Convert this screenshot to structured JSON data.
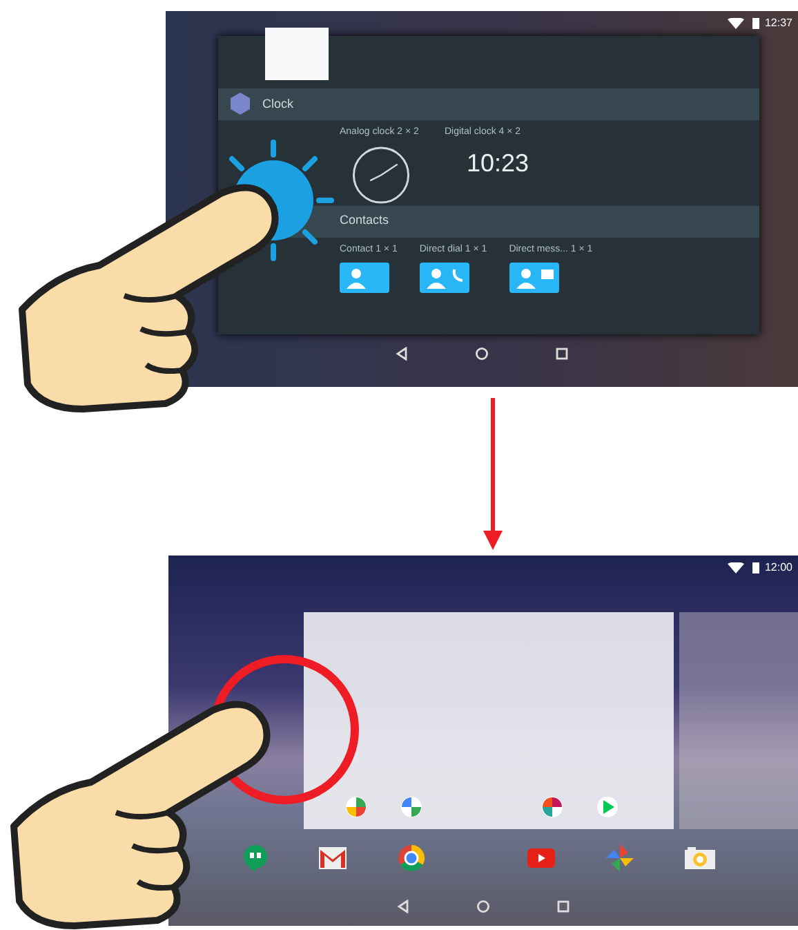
{
  "top_screen": {
    "status_time": "12:37",
    "widget_groups": [
      {
        "title": "Clock",
        "widgets": [
          {
            "label": "Analog clock 2 × 2",
            "kind": "analog"
          },
          {
            "label": "Digital clock 4 × 2",
            "kind": "digital",
            "time": "10:23"
          }
        ]
      },
      {
        "title": "Contacts",
        "widgets": [
          {
            "label": "Contact 1 × 1",
            "kind": "contact"
          },
          {
            "label": "Direct dial 1 × 1",
            "kind": "dial"
          },
          {
            "label": "Direct mess...  1 × 1",
            "kind": "message"
          }
        ]
      }
    ]
  },
  "bottom_screen": {
    "status_time": "12:00"
  }
}
